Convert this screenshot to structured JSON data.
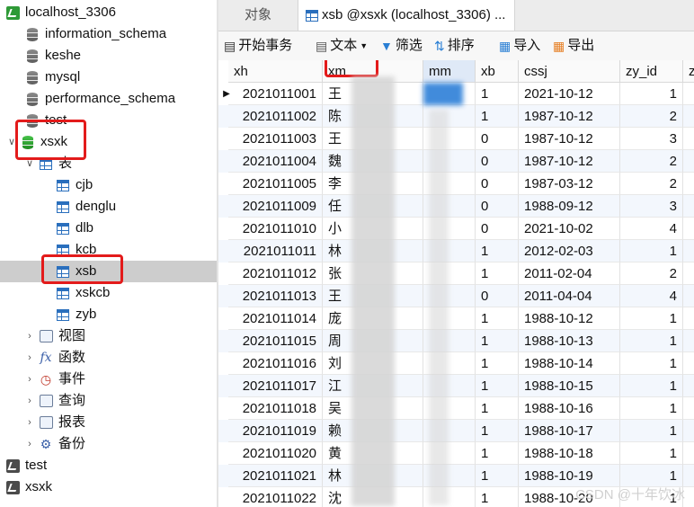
{
  "tree": {
    "connection": "localhost_3306",
    "databases": [
      "information_schema",
      "keshe",
      "mysql",
      "performance_schema",
      "test",
      "xsxk"
    ],
    "tables_group": "表",
    "tables": [
      "cjb",
      "denglu",
      "dlb",
      "kcb",
      "xsb",
      "xskcb",
      "zyb"
    ],
    "groups": [
      "视图",
      "函数",
      "事件",
      "查询",
      "报表",
      "备份"
    ],
    "other_connections": [
      "test",
      "xsxk"
    ]
  },
  "tabs": {
    "objects": "对象",
    "active": "xsb @xsxk (localhost_3306) ..."
  },
  "toolbar": {
    "begin_transaction": "开始事务",
    "text": "文本",
    "filter": "筛选",
    "sort": "排序",
    "import": "导入",
    "export": "导出"
  },
  "columns": [
    "xh",
    "xm",
    "mm",
    "xb",
    "cssj",
    "zy_id",
    "zx"
  ],
  "rows": [
    {
      "xh": "2021011001",
      "xm": "王",
      "xb": "1",
      "cssj": "2021-10-12",
      "zy_id": "1"
    },
    {
      "xh": "2021011002",
      "xm": "陈",
      "xb": "1",
      "cssj": "1987-10-12",
      "zy_id": "2"
    },
    {
      "xh": "2021011003",
      "xm": "王",
      "xb": "0",
      "cssj": "1987-10-12",
      "zy_id": "3"
    },
    {
      "xh": "2021011004",
      "xm": "魏",
      "xb": "0",
      "cssj": "1987-10-12",
      "zy_id": "2"
    },
    {
      "xh": "2021011005",
      "xm": "李",
      "xb": "0",
      "cssj": "1987-03-12",
      "zy_id": "2"
    },
    {
      "xh": "2021011009",
      "xm": "任",
      "xb": "0",
      "cssj": "1988-09-12",
      "zy_id": "3"
    },
    {
      "xh": "2021011010",
      "xm": "小",
      "xb": "0",
      "cssj": "2021-10-02",
      "zy_id": "4"
    },
    {
      "xh": "2021011011",
      "xm": "林",
      "xb": "1",
      "cssj": "2012-02-03",
      "zy_id": "1"
    },
    {
      "xh": "2021011012",
      "xm": "张",
      "xb": "1",
      "cssj": "2011-02-04",
      "zy_id": "2"
    },
    {
      "xh": "2021011013",
      "xm": "王",
      "xb": "0",
      "cssj": "2011-04-04",
      "zy_id": "4"
    },
    {
      "xh": "2021011014",
      "xm": "庞",
      "xb": "1",
      "cssj": "1988-10-12",
      "zy_id": "1"
    },
    {
      "xh": "2021011015",
      "xm": "周",
      "xb": "1",
      "cssj": "1988-10-13",
      "zy_id": "1"
    },
    {
      "xh": "2021011016",
      "xm": "刘",
      "xb": "1",
      "cssj": "1988-10-14",
      "zy_id": "1"
    },
    {
      "xh": "2021011017",
      "xm": "江",
      "xb": "1",
      "cssj": "1988-10-15",
      "zy_id": "1"
    },
    {
      "xh": "2021011018",
      "xm": "吴",
      "xb": "1",
      "cssj": "1988-10-16",
      "zy_id": "1"
    },
    {
      "xh": "2021011019",
      "xm": "赖",
      "xb": "1",
      "cssj": "1988-10-17",
      "zy_id": "1"
    },
    {
      "xh": "2021011020",
      "xm": "黄",
      "xb": "1",
      "cssj": "1988-10-18",
      "zy_id": "1"
    },
    {
      "xh": "2021011021",
      "xm": "林",
      "xb": "1",
      "cssj": "1988-10-19",
      "zy_id": "1"
    },
    {
      "xh": "2021011022",
      "xm": "沈",
      "xb": "1",
      "cssj": "1988-10-20",
      "zy_id": "1"
    }
  ],
  "watermark": "CSDN @十年饮冰",
  "colors": {
    "highlight": "#e31b1b",
    "selection": "#cdcdcd",
    "accent": "#2a6fbd"
  }
}
